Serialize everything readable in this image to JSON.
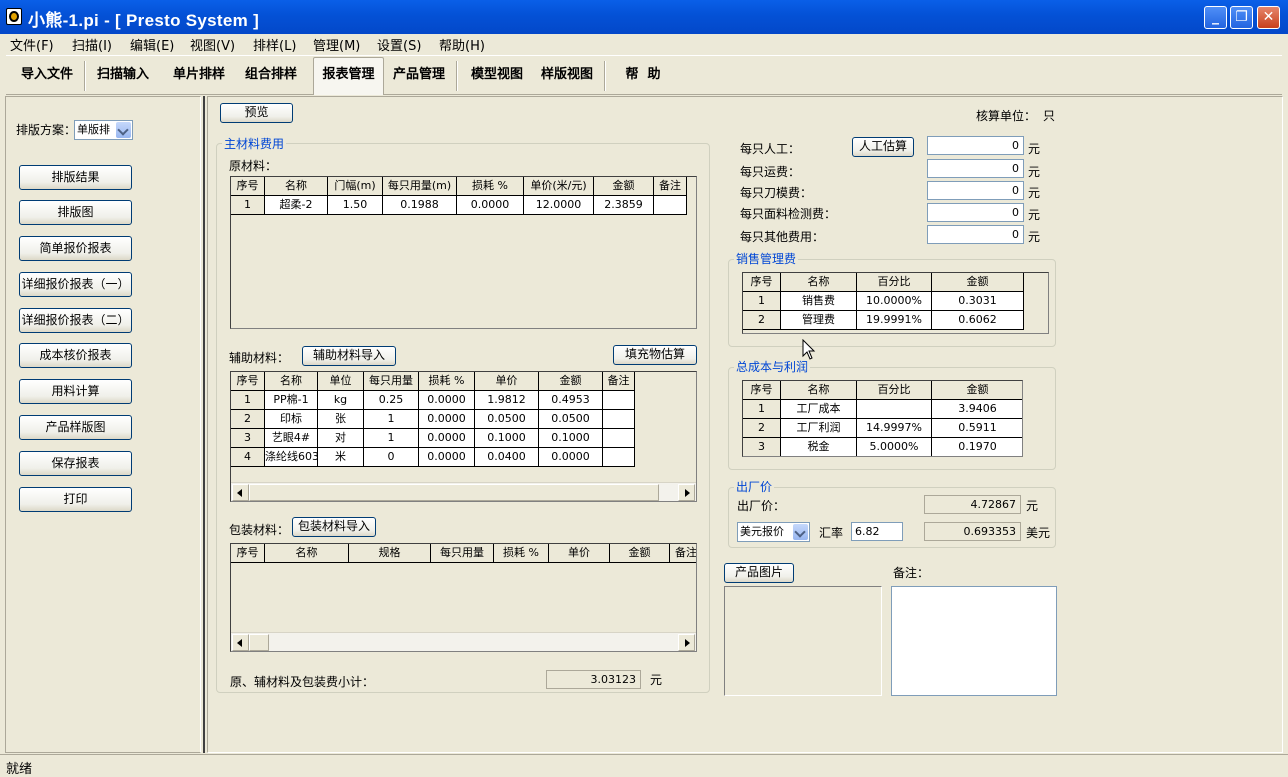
{
  "window": {
    "title": "小熊-1.pi - [ Presto System ]",
    "controls": {
      "minimize": "_",
      "restore": "❐",
      "close": "✕"
    }
  },
  "menu": [
    "文件(F)",
    "扫描(I)",
    "编辑(E)",
    "视图(V)",
    "排样(L)",
    "管理(M)",
    "设置(S)",
    "帮助(H)"
  ],
  "toolbar": [
    "导入文件",
    "扫描输入",
    "单片排样",
    "组合排样",
    "报表管理",
    "产品管理",
    "模型视图",
    "样版视图",
    "帮  助"
  ],
  "toolbar_active": "报表管理",
  "left": {
    "scheme_label": "排版方案：",
    "scheme_value": "单版排",
    "buttons": [
      "排版结果",
      "排版图",
      "简单报价报表",
      "详细报价报表（一）",
      "详细报价报表（二）",
      "成本核价报表",
      "用料计算",
      "产品样版图",
      "保存报表",
      "打印"
    ]
  },
  "main": {
    "preview_button": "预览",
    "unit_label": "核算单位：",
    "unit_value": "只",
    "material_group": "主材料费用",
    "raw_label": "原材料：",
    "raw_table": {
      "headers": [
        "序号",
        "名称",
        "门幅(m)",
        "每只用量(m)",
        "损耗 %",
        "单价(米/元)",
        "金额",
        "备注"
      ],
      "rows": [
        [
          "1",
          "超柔-2",
          "1.50",
          "0.1988",
          "0.0000",
          "12.0000",
          "2.3859",
          ""
        ]
      ]
    },
    "aux_label": "辅助材料：",
    "aux_import_button": "辅助材料导入",
    "fill_estimate_button": "填充物估算",
    "aux_table": {
      "headers": [
        "序号",
        "名称",
        "单位",
        "每只用量",
        "损耗 %",
        "单价",
        "金额",
        "备注"
      ],
      "rows": [
        [
          "1",
          "PP棉-1",
          "kg",
          "0.25",
          "0.0000",
          "1.9812",
          "0.4953",
          ""
        ],
        [
          "2",
          "印标",
          "张",
          "1",
          "0.0000",
          "0.0500",
          "0.0500",
          ""
        ],
        [
          "3",
          "艺眼4#",
          "对",
          "1",
          "0.0000",
          "0.1000",
          "0.1000",
          ""
        ],
        [
          "4",
          "涤纶线603",
          "米",
          "0",
          "0.0000",
          "0.0400",
          "0.0000",
          ""
        ]
      ]
    },
    "pack_label": "包装材料：",
    "pack_import_button": "包装材料导入",
    "pack_table": {
      "headers": [
        "序号",
        "名称",
        "规格",
        "每只用量",
        "损耗 %",
        "单价",
        "金额",
        "备注"
      ],
      "rows": []
    },
    "subtotal_label": "原、辅材料及包装费小计：",
    "subtotal_value": "3.03123",
    "yuan": "元",
    "labor_label": "每只人工：",
    "labor_estimate_button": "人工估算",
    "labor_value": "0",
    "freight_label": "每只运费：",
    "freight_value": "0",
    "die_label": "每只刀模费：",
    "die_value": "0",
    "inspect_label": "每只面料检测费：",
    "inspect_value": "0",
    "other_label": "每只其他费用：",
    "other_value": "0",
    "sales_group": "销售管理费",
    "sales_table": {
      "headers": [
        "序号",
        "名称",
        "百分比",
        "金额"
      ],
      "rows": [
        [
          "1",
          "销售费",
          "10.0000%",
          "0.3031"
        ],
        [
          "2",
          "管理费",
          "19.9991%",
          "0.6062"
        ]
      ]
    },
    "total_group": "总成本与利润",
    "total_table": {
      "headers": [
        "序号",
        "名称",
        "百分比",
        "金额"
      ],
      "rows": [
        [
          "1",
          "工厂成本",
          "",
          "3.9406"
        ],
        [
          "2",
          "工厂利润",
          "14.9997%",
          "0.5911"
        ],
        [
          "3",
          "税金",
          "5.0000%",
          "0.1970"
        ]
      ]
    },
    "ex_group": "出厂价",
    "ex_label": "出厂价：",
    "ex_value": "4.72867",
    "currency_select": "美元报价",
    "rate_label": "汇率",
    "rate_value": "6.82",
    "usd_value": "0.693353",
    "usd_unit": "美元",
    "product_image_button": "产品图片",
    "remark_label": "备注："
  },
  "status": "就绪"
}
